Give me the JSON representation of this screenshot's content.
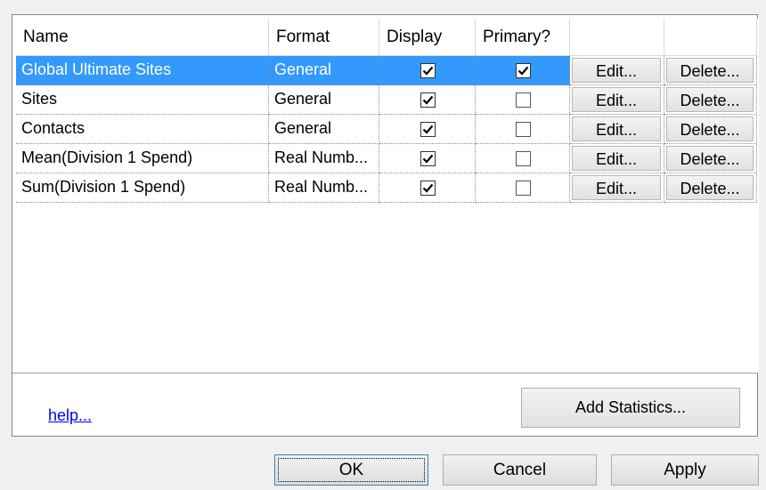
{
  "columns": [
    "Name",
    "Format",
    "Display",
    "Primary?",
    "",
    ""
  ],
  "rows": [
    {
      "name": "Global Ultimate Sites",
      "format": "General",
      "display": true,
      "primary": true,
      "edit": "Edit...",
      "delete": "Delete..."
    },
    {
      "name": "Sites",
      "format": "General",
      "display": true,
      "primary": false,
      "edit": "Edit...",
      "delete": "Delete..."
    },
    {
      "name": "Contacts",
      "format": "General",
      "display": true,
      "primary": false,
      "edit": "Edit...",
      "delete": "Delete..."
    },
    {
      "name": "Mean(Division 1 Spend)",
      "format": "Real Numb...",
      "display": true,
      "primary": false,
      "edit": "Edit...",
      "delete": "Delete..."
    },
    {
      "name": "Sum(Division 1 Spend)",
      "format": "Real Numb...",
      "display": true,
      "primary": false,
      "edit": "Edit...",
      "delete": "Delete..."
    }
  ],
  "selected_row": 0,
  "help_link": "help...",
  "add_statistics_button": "Add Statistics...",
  "dialog_buttons": {
    "ok": "OK",
    "cancel": "Cancel",
    "apply": "Apply"
  },
  "colors": {
    "selection": "#3399ff",
    "link": "#0000ee"
  }
}
